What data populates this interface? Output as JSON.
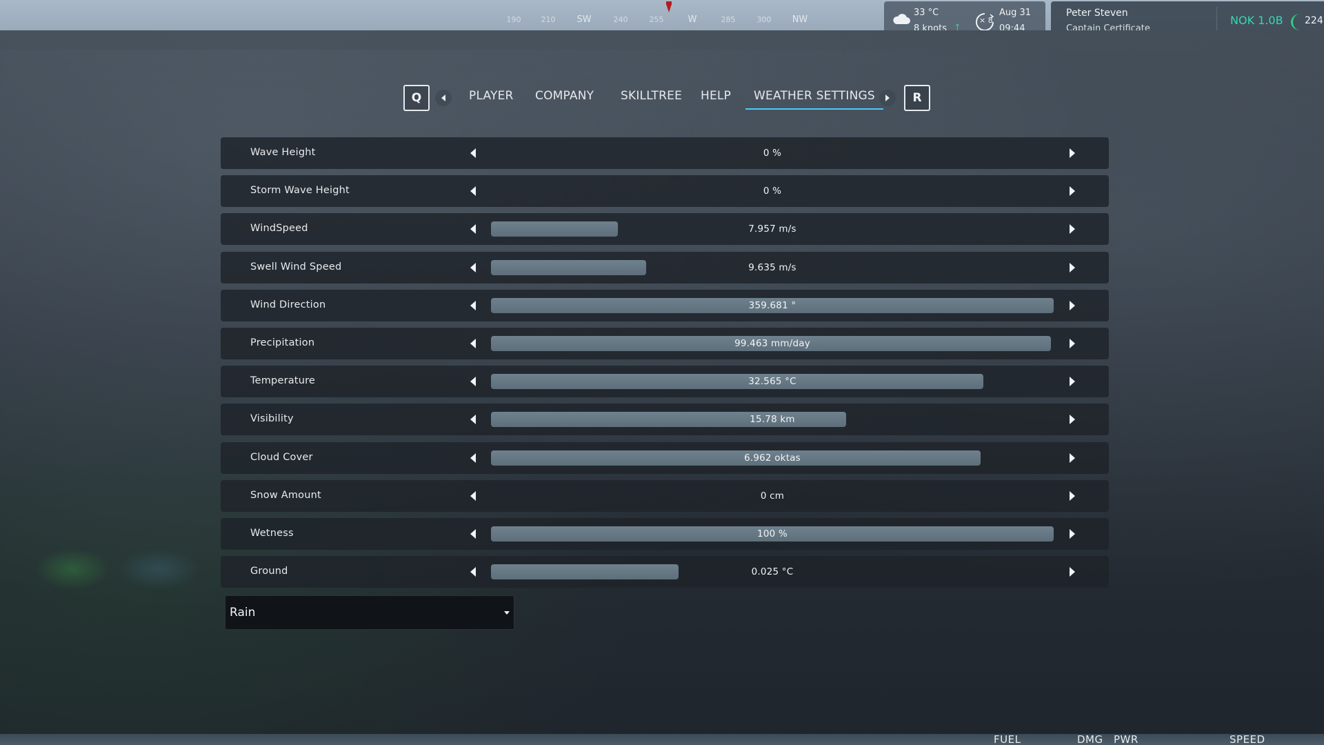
{
  "hud": {
    "compass": [
      "190",
      "210",
      "SW",
      "240",
      "255",
      "W",
      "285",
      "300",
      "NW"
    ],
    "weather": {
      "temperature": "33 °C",
      "wind": "8 knots",
      "wind_arrow": "↑"
    },
    "time_speed": "× 8",
    "date": "Aug 31",
    "time": "09:44",
    "player_name": "Peter Steven",
    "certificate": "Captain Certificate",
    "money": "NOK 1.0B",
    "gauge_value": "224",
    "bottom_labels": [
      "FUEL",
      "DMG",
      "PWR",
      "SPEED"
    ]
  },
  "tabs": {
    "left_key": "Q",
    "right_key": "R",
    "items": [
      {
        "label": "PLAYER",
        "active": false
      },
      {
        "label": "COMPANY",
        "active": false
      },
      {
        "label": "SKILLTREE",
        "active": false
      },
      {
        "label": "HELP",
        "active": false
      },
      {
        "label": "WEATHER SETTINGS",
        "active": true
      }
    ]
  },
  "settings": [
    {
      "label": "Wave Height",
      "value": "0 %",
      "fill": 0
    },
    {
      "label": "Storm Wave Height",
      "value": "0 %",
      "fill": 0
    },
    {
      "label": "WindSpeed",
      "value": "7.957 m/s",
      "fill": 0.225
    },
    {
      "label": "Swell Wind Speed",
      "value": "9.635 m/s",
      "fill": 0.276
    },
    {
      "label": "Wind Direction",
      "value": "359.681 °",
      "fill": 1.0
    },
    {
      "label": "Precipitation",
      "value": "99.463 mm/day",
      "fill": 0.995
    },
    {
      "label": "Temperature",
      "value": "32.565 °C",
      "fill": 0.875
    },
    {
      "label": "Visibility",
      "value": "15.78 km",
      "fill": 0.631
    },
    {
      "label": "Cloud Cover",
      "value": "6.962 oktas",
      "fill": 0.87
    },
    {
      "label": "Snow Amount",
      "value": "0 cm",
      "fill": 0
    },
    {
      "label": "Wetness",
      "value": "100 %",
      "fill": 1.0
    },
    {
      "label": "Ground",
      "value": "0.025 °C",
      "fill": 0.333
    }
  ],
  "weather_preset": {
    "selected": "Rain"
  }
}
